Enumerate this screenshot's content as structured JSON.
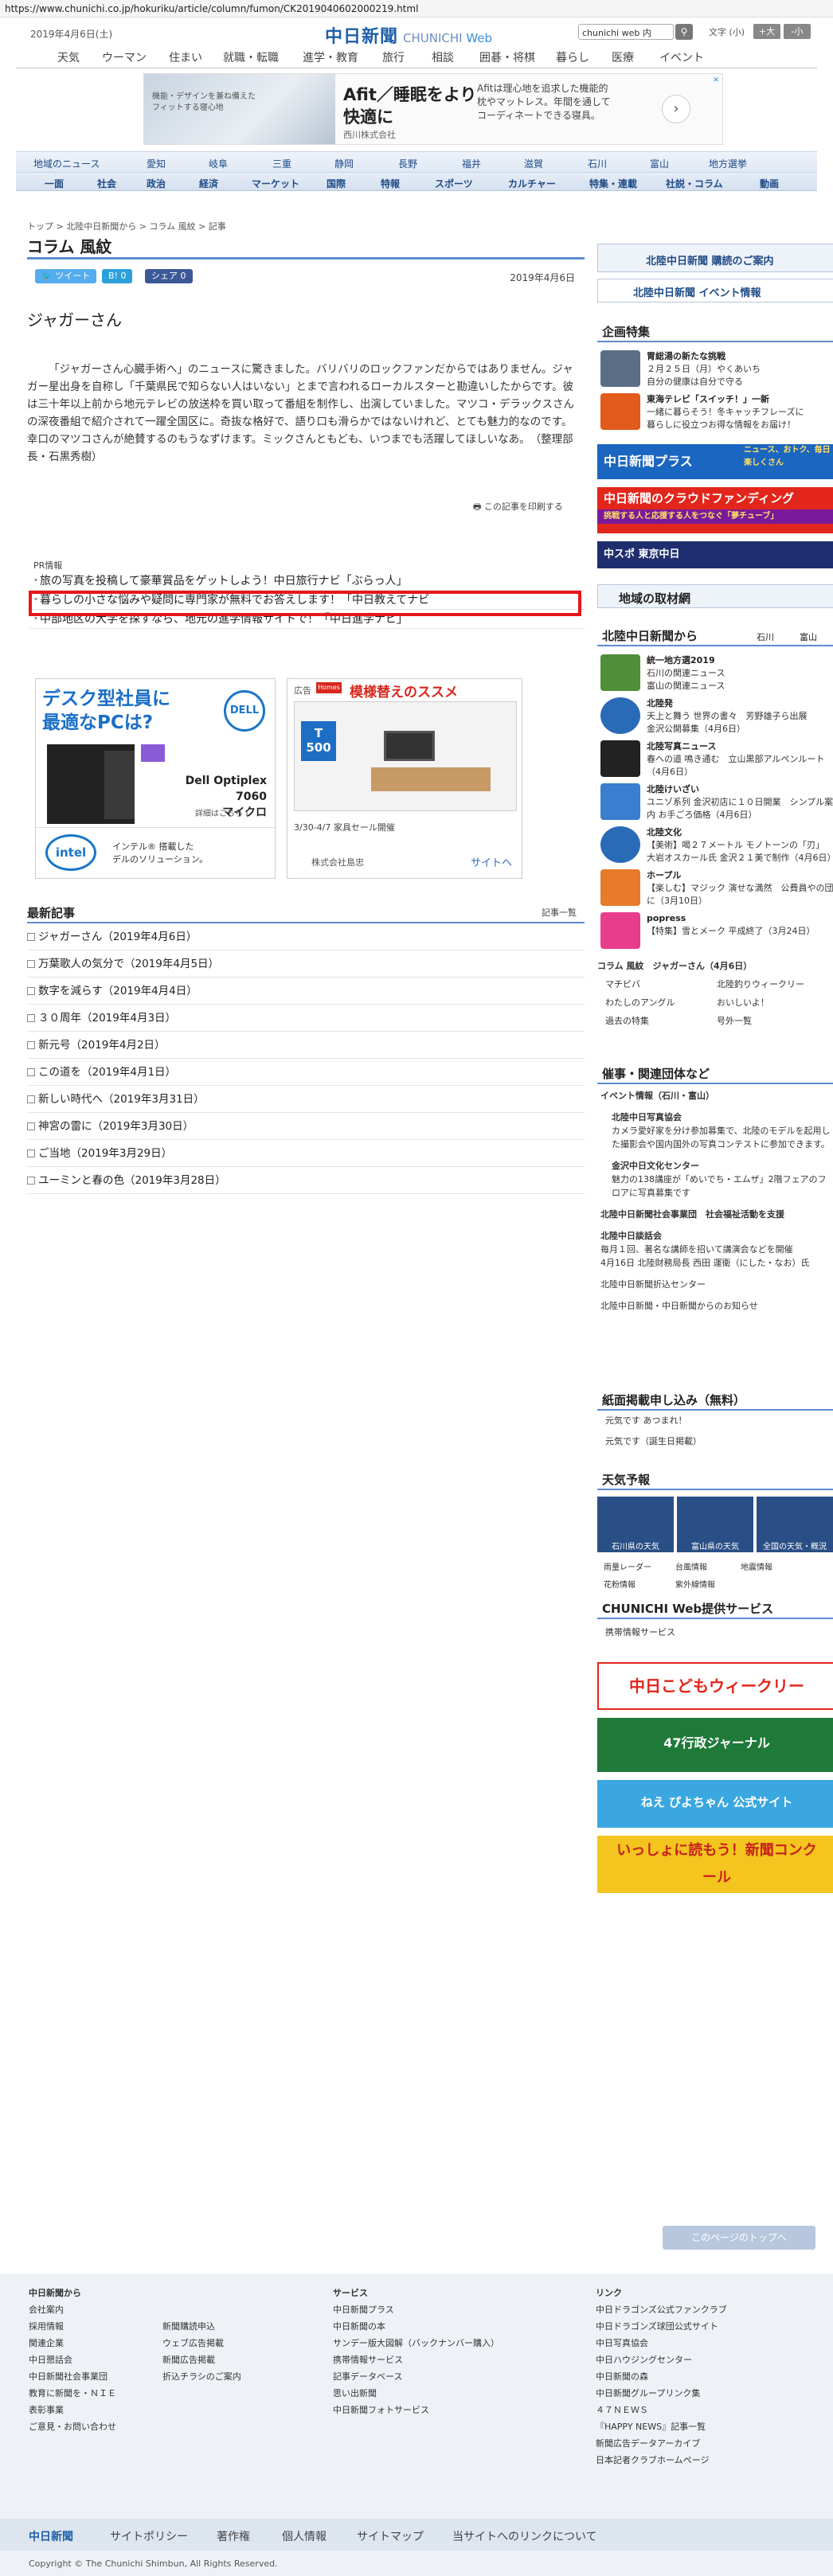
{
  "url": "https://www.chunichi.co.jp/hokuriku/article/column/fumon/CK2019040602000219.html",
  "header": {
    "date": "2019年4月6日(土)",
    "logo": "中日新聞",
    "logo_en_1": "CHUNICHI",
    "logo_en_2": "Web",
    "search_placeholder": "chunichi web 内",
    "search_icon": "search-icon",
    "font_size_label": "文字",
    "font_mid": "(小)",
    "font_large": "+大",
    "font_small": "-小"
  },
  "gnav": [
    "天気",
    "ウーマン",
    "住まい",
    "就職・転職",
    "進学・教育",
    "旅行",
    "相談",
    "囲碁・将棋",
    "暮らし",
    "医療",
    "イベント"
  ],
  "ad_top": {
    "img_text": "機能・デザインを兼ね備えた\nフィットする寝心地",
    "headline": "Afit／睡眠をより\n快適に",
    "company": "西川株式会社",
    "desc": "Afitは理心地を追求した機能的枕やマットレス。年間を通してコーディネートできる寝具。",
    "arrow": "›"
  },
  "region_nav": [
    "地域のニュース",
    "愛知",
    "岐阜",
    "三重",
    "静岡",
    "長野",
    "福井",
    "滋賀",
    "石川",
    "富山",
    "地方選挙"
  ],
  "section_nav": [
    "一面",
    "社会",
    "政治",
    "経済",
    "マーケット",
    "国際",
    "特報",
    "スポーツ",
    "カルチャー",
    "特集・連載",
    "社説・コラム",
    "動画"
  ],
  "breadcrumb": "トップ > 北陸中日新聞から > コラム 風紋 > 記事",
  "page_title": "コラム 風紋",
  "social": {
    "tweet": "ツイート",
    "hatena": "B! 0",
    "share": "シェア 0"
  },
  "article": {
    "date": "2019年4月6日",
    "title": "ジャガーさん",
    "body": "「ジャガーさん心臓手術へ」のニュースに驚きました。バリバリのロックファンだからではありません。ジャガー星出身を自称し「千葉県民で知らない人はいない」とまで言われるローカルスターと勘違いしたからです。彼は三十年以上前から地元テレビの放送枠を買い取って番組を制作し、出演していました。マツコ・デラックスさんの深夜番組で紹介されて一躍全国区に。奇抜な格好で、語り口も滑らかではないけれど、とても魅力的なのです。幸口のマツコさんが絶賛するのもうなずけます。ミックさんともども、いつまでも活躍してほしいなあ。　（整理部長・石黒秀樹）",
    "print": "この記事を印刷する"
  },
  "pr": {
    "label": "PR情報",
    "items": [
      "旅の写真を投稿して豪華賞品をゲットしよう！中日旅行ナビ「ぶらっ人」",
      "暮らしの小さな悩みや疑問に専門家が無料でお答えします！「中日教えてナビ",
      "中部地区の大学を探すなら、地元の進学情報サイトで！「中日進学ナビ」"
    ]
  },
  "ad_dell": {
    "headline": "デスク型社員に\n最適なPCは?",
    "logo": "DELL",
    "model": "Dell Optiplex 7060\nマイクロ",
    "more": "詳細はこちら ›",
    "intel": "intel",
    "intel_text": "インテル® 搭載した\nデルのソリューション。"
  },
  "ad_furniture": {
    "label": "広告",
    "brand": "Homes",
    "headline": "模様替えのススメ",
    "t_text": "T\n500",
    "dates": "3/30-4/7 家具セール開催",
    "company": "株式会社島忠",
    "site": "サイトへ"
  },
  "latest": {
    "title": "最新記事",
    "more": "記事一覧",
    "items": [
      "ジャガーさん（2019年4月6日）",
      "万葉歌人の気分で（2019年4月5日）",
      "数字を減らす（2019年4月4日）",
      "３０周年（2019年4月3日）",
      "新元号（2019年4月2日）",
      "この道を（2019年4月1日）",
      "新しい時代へ（2019年3月31日）",
      "神宮の雷に（2019年3月30日）",
      "ご当地（2019年3月29日）",
      "ユーミンと春の色（2019年3月28日）"
    ]
  },
  "side": {
    "subscribe": "北陸中日新聞 購読のご案内",
    "events": "北陸中日新聞 イベント情報",
    "feature_title": "企画特集",
    "features": [
      {
        "t": "胃総湯の新たな挑戦",
        "d": "２月２５日（月）やくあいち\n自分の健康は自分で守る"
      },
      {
        "t": "東海テレビ「スイッチ！」一新",
        "d": "一緒に暮らそう！冬キャッチフレーズに\n暮らしに役立つお得な情報をお届け！"
      }
    ],
    "plus": "中日新聞プラス",
    "plus_sub": "ニュース、おトク、毎日楽しくさん",
    "crowd": "中日新聞のクラウドファンディング",
    "crowd_sub": "挑戦する人と応援する人をつなぐ「夢チューブ」",
    "sports": "中スポ 東京中日",
    "local": "地域の取材網",
    "from_title": "北陸中日新聞から",
    "from_links": [
      "石川",
      "富山"
    ],
    "from_items": [
      {
        "t": "統一地方選2019",
        "d": "石川の関連ニュース\n富山の関連ニュース"
      },
      {
        "t": "北陸発",
        "d": "天上と舞う 世界の書々　芳野雄子ら出展\n金沢公開募集（4月6日）"
      },
      {
        "t": "北陸写真ニュース",
        "d": "春への道 鳴き通む　立山黒部アルペンルート（4月6日）"
      },
      {
        "t": "北陸けいざい",
        "d": "ユニゾ系列 金沢初店に１０日開業　シンプル案内 お手ごろ価格（4月6日）"
      },
      {
        "t": "北陸文化",
        "d": "【美術】喝２７メートル モノトーンの「刃」　大岩オスカール氏 金沢２１美で制作（4月6日）"
      },
      {
        "t": "ホープル",
        "d": "【楽しむ】マジック 演せな満然　公費員やの団に（3月10日）"
      },
      {
        "t": "popress",
        "d": "【特集】雪とメーク 平成終了（3月24日）"
      }
    ],
    "links": [
      "コラム 風紋　ジャガーさん（4月6日）",
      "マチビバ",
      "北陸釣りウィークリー",
      "わたしのアングル",
      "おいしいよ！",
      "過去の特集",
      "号外一覧"
    ],
    "events_title": "催事・関連団体など",
    "events_items": [
      "イベント情報（石川・富山）",
      "北陸中日写真協会",
      "カメラ愛好家を分け参加募集で、北陸のモデルを起用した撮影会や国内国外の写真コンテストに参加できます。",
      "金沢中日文化センター",
      "魅力の138講座が「めいでち・エムザ」2階フェアのフロアに写真募集です",
      "北陸中日新聞社会事業団　社会福祉活動を支援",
      "北陸中日談話会",
      "毎月１回、著名な講師を招いて講演会などを開催",
      "4月16日 北陸財務局長 西田 運衛（にした・なお）氏",
      "北陸中日新聞折込センター",
      "北陸中日新聞・中日新聞からのお知らせ"
    ],
    "paper_title": "紙面掲載申し込み（無料）",
    "paper_items": [
      "元気です あつまれ！",
      "元気です（誕生日掲載）"
    ],
    "weather_title": "天気予報",
    "weather": [
      "石川県の天気",
      "富山県の天気",
      "全国の天気・概況"
    ],
    "weather_links": [
      "雨量レーダー",
      "台風情報",
      "地震情報",
      "花粉情報",
      "紫外線情報"
    ],
    "service_title": "CHUNICHI Web提供サービス",
    "service_items": [
      "携帯情報サービス"
    ],
    "banners": [
      "中日こどもウィークリー",
      "47行政ジャーナル",
      "ねえ ぴよちゃん 公式サイト",
      "いっしょに読もう！新聞コンクール"
    ]
  },
  "totop": "このページのトップへ",
  "footer": {
    "col1": [
      "中日新聞から",
      "会社案内",
      "採用情報",
      "関連企業",
      "中日懇話会",
      "中日新聞社会事業団",
      "教育に新聞を・ＮＩＥ",
      "表彰事業",
      "ご意見・お問い合わせ"
    ],
    "col2": [
      "新聞購読申込",
      "ウェブ広告掲載",
      "新聞広告掲載",
      "折込チラシのご案内"
    ],
    "col3": [
      "サービス",
      "中日新聞プラス",
      "中日新聞の本",
      "サンデー版大図解（バックナンバー購入）",
      "携帯情報サービス",
      "記事データベース",
      "思い出新聞",
      "中日新聞フォトサービス"
    ],
    "col4": [
      "リンク",
      "中日ドラゴンズ公式ファンクラブ",
      "中日ドラゴンズ球団公式サイト",
      "中日写真協会",
      "中日ハウジングセンター",
      "中日新聞の森",
      "中日新聞グループリンク集",
      "４７ＮＥＷＳ",
      "『HAPPY NEWS』記事一覧",
      "新聞広告データアーカイブ",
      "日本記者クラブホームページ"
    ],
    "bar": [
      "中日新聞",
      "サイトポリシー",
      "著作権",
      "個人情報",
      "サイトマップ",
      "当サイトへのリンクについて"
    ],
    "copyright": "Copyright © The Chunichi Shimbun, All Rights Reserved."
  }
}
